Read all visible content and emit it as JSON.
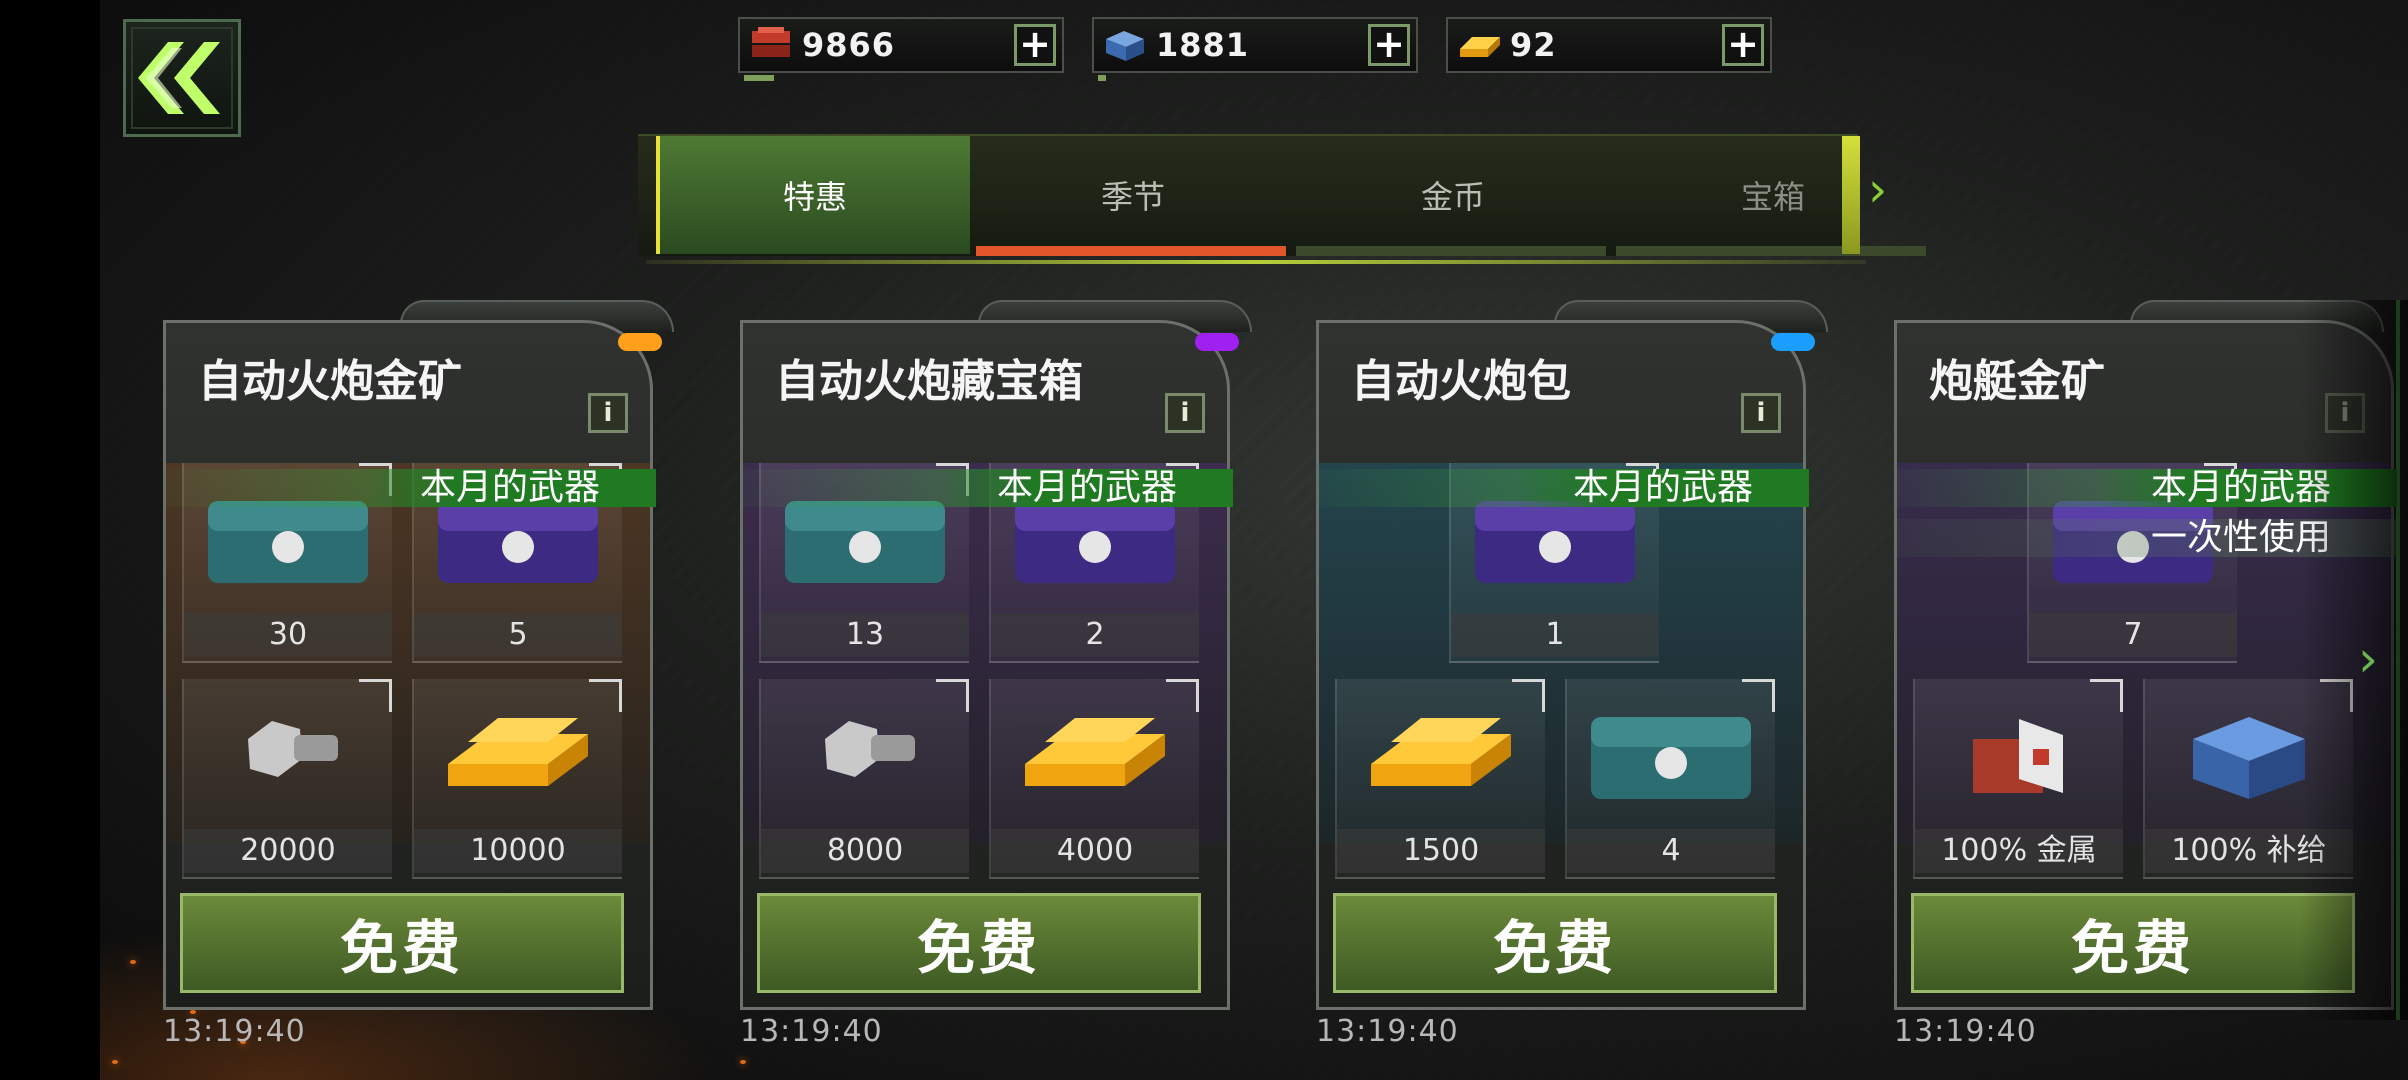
{
  "currencies": [
    {
      "icon": "red-metal-icon",
      "value": "9866",
      "plus": "+"
    },
    {
      "icon": "blue-supply-icon",
      "value": "1881",
      "plus": "+"
    },
    {
      "icon": "gold-bar-icon",
      "value": "92",
      "plus": "+"
    }
  ],
  "tabs": [
    "特惠",
    "季节",
    "金币",
    "宝箱"
  ],
  "cards": [
    {
      "title": "自动火炮金矿",
      "banner": "本月的武器",
      "slots": [
        "30",
        "5",
        "20000",
        "10000"
      ],
      "button": "免费",
      "timer": "13:19:40"
    },
    {
      "title": "自动火炮藏宝箱",
      "banner": "本月的武器",
      "slots": [
        "13",
        "2",
        "8000",
        "4000"
      ],
      "button": "免费",
      "timer": "13:19:40"
    },
    {
      "title": "自动火炮包",
      "banner": "本月的武器",
      "slots": [
        "1",
        "1500",
        "4"
      ],
      "button": "免费",
      "timer": "13:19:40"
    },
    {
      "title": "炮艇金矿",
      "banner": "本月的武器",
      "banner2": "一次性使用",
      "slots": [
        "7",
        "100% 金属",
        "100% 补给"
      ],
      "button": "免费",
      "timer": "13:19:40"
    }
  ],
  "colors": {
    "accent_green": "#4e7a34",
    "tab_underline_active": "#e0552a",
    "gold": "#f5b320"
  }
}
